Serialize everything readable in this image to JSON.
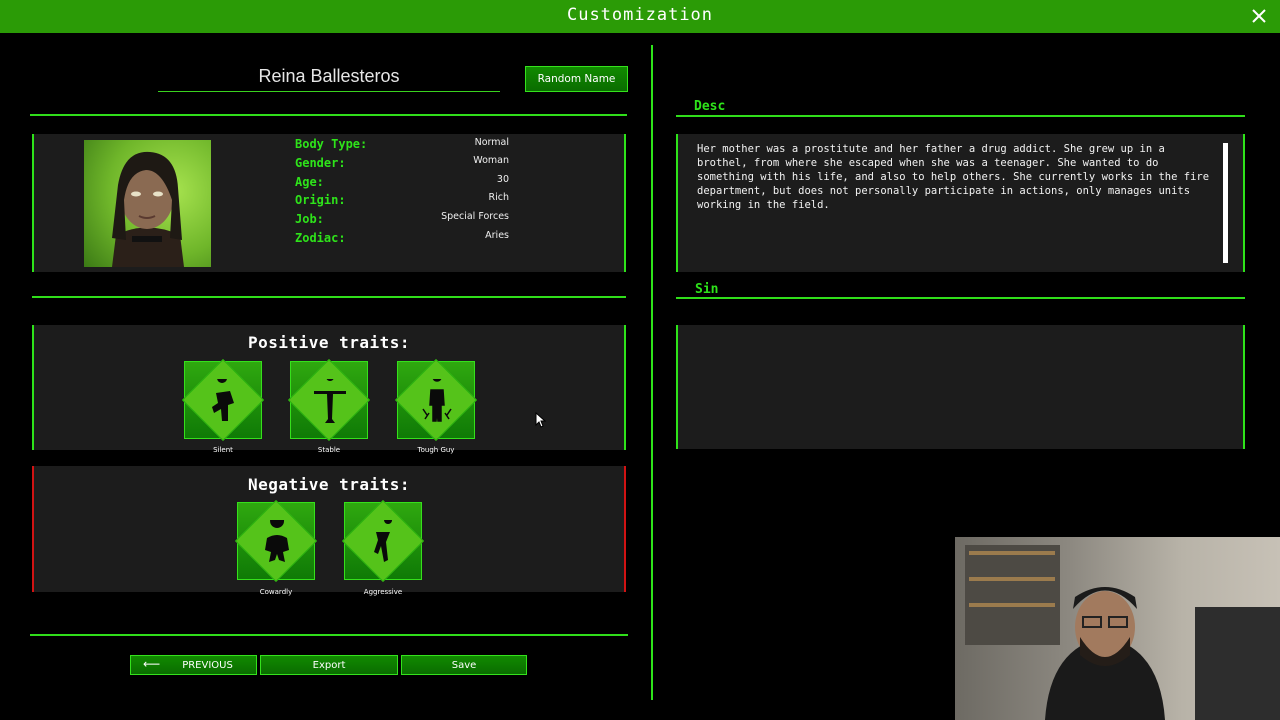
{
  "window": {
    "title": "Customization"
  },
  "character": {
    "name": "Reina Ballesteros",
    "random_name_label": "Random Name",
    "stats": [
      {
        "label": "Body Type:",
        "value": "Normal"
      },
      {
        "label": "Gender:",
        "value": "Woman"
      },
      {
        "label": "Age:",
        "value": "30"
      },
      {
        "label": "Origin:",
        "value": "Rich"
      },
      {
        "label": "Job:",
        "value": "Special Forces"
      },
      {
        "label": "Zodiac:",
        "value": "Aries"
      }
    ]
  },
  "positive_traits": {
    "title": "Positive traits:",
    "items": [
      {
        "name": "Silent",
        "icon": "silent-trait-icon"
      },
      {
        "name": "Stable",
        "icon": "stable-trait-icon"
      },
      {
        "name": "Tough Guy",
        "icon": "tough-guy-trait-icon"
      }
    ]
  },
  "negative_traits": {
    "title": "Negative traits:",
    "items": [
      {
        "name": "Cowardly",
        "icon": "cowardly-trait-icon"
      },
      {
        "name": "Aggressive",
        "icon": "aggressive-trait-icon"
      }
    ]
  },
  "desc": {
    "label": "Desc",
    "text": "Her mother was a prostitute and her father a drug addict. She grew up in a brothel, from where she escaped when she was a teenager. She wanted to do something with his life, and also to help others. She currently works in the fire department, but does not personally participate in actions, only manages units working in the field."
  },
  "sin": {
    "label": "Sin",
    "text": ""
  },
  "footer": {
    "previous_label": "PREVIOUS",
    "export_label": "Export",
    "save_label": "Save"
  },
  "colors": {
    "accent": "#2ee31a",
    "title_bar": "#2b9b06",
    "button": "#0a6c00",
    "negative": "#d11313",
    "panel": "#1c1c1c"
  }
}
